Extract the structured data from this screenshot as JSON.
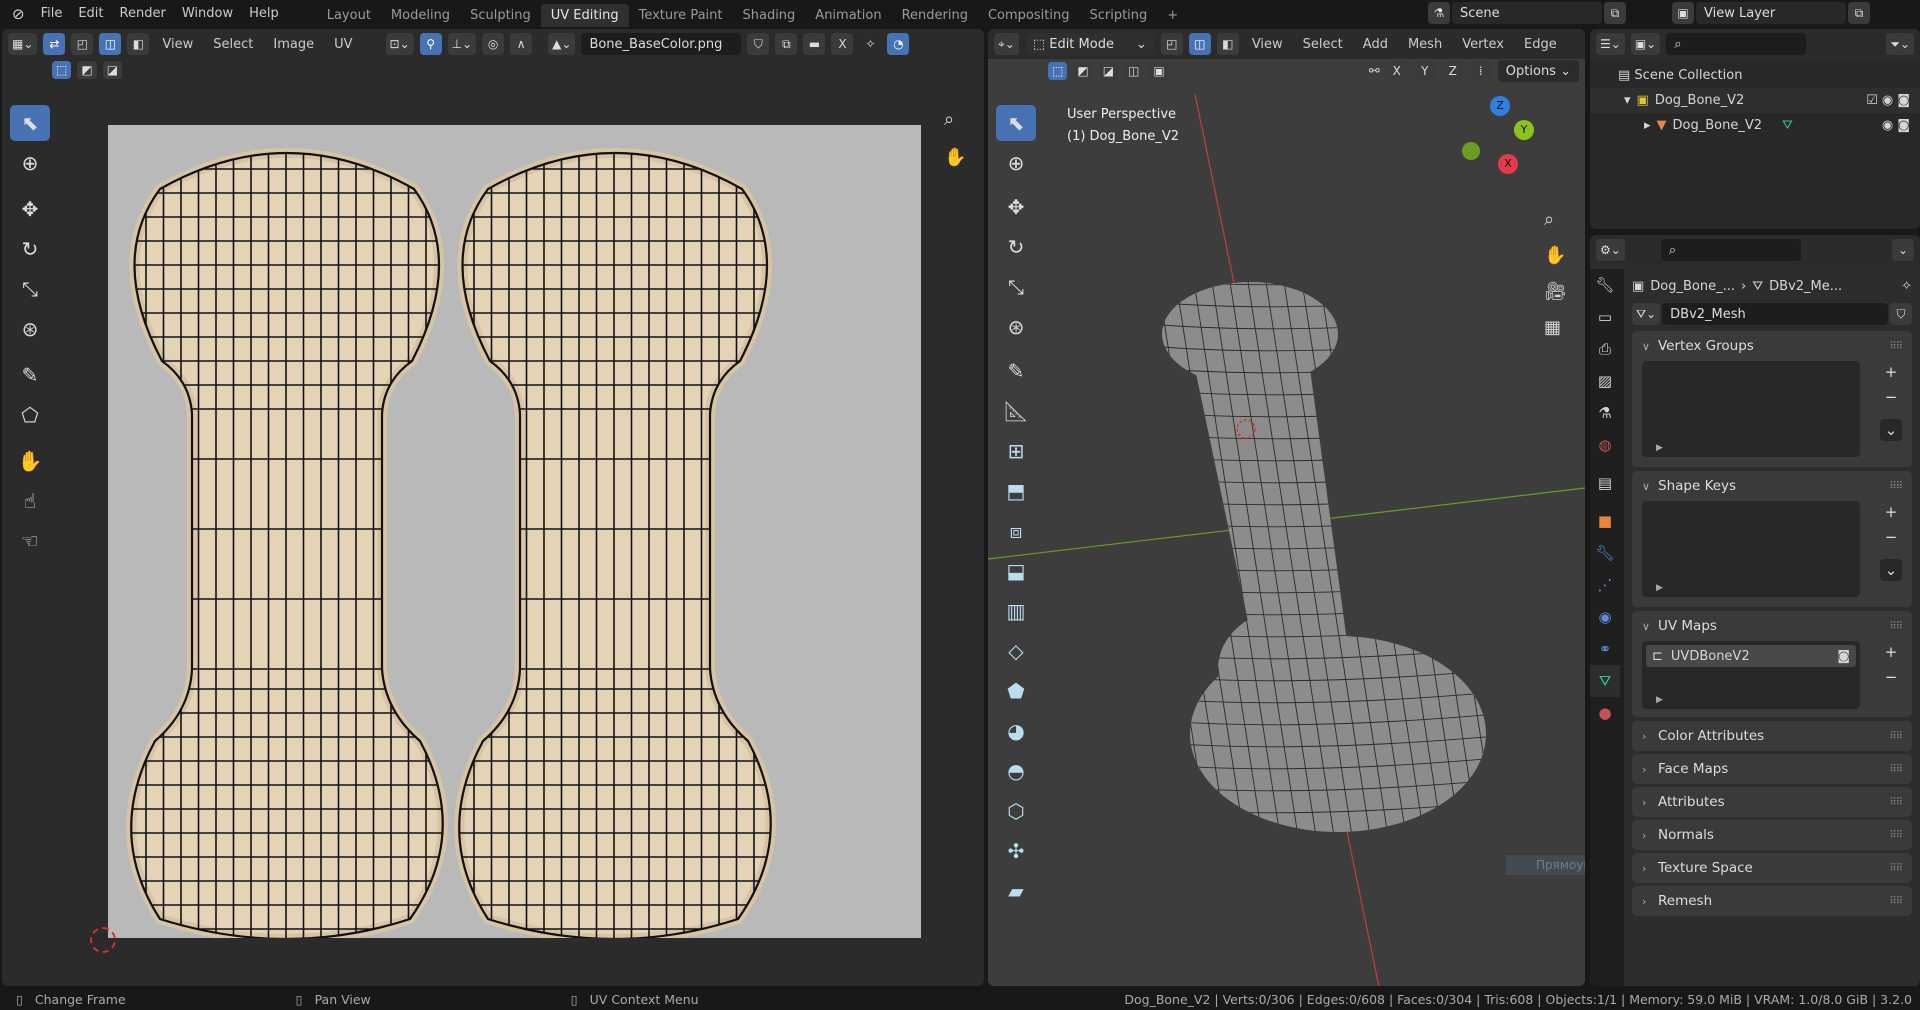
{
  "topbar": {
    "menus": [
      "File",
      "Edit",
      "Render",
      "Window",
      "Help"
    ],
    "workspaces": [
      "Layout",
      "Modeling",
      "Sculpting",
      "UV Editing",
      "Texture Paint",
      "Shading",
      "Animation",
      "Rendering",
      "Compositing",
      "Scripting"
    ],
    "active_workspace": "UV Editing",
    "add_tab": "+",
    "scene": "Scene",
    "view_layer": "View Layer"
  },
  "uv_editor": {
    "menus": [
      "View",
      "Select",
      "Image",
      "UV"
    ],
    "image_name": "Bone_BaseColor.png",
    "close": "X"
  },
  "viewport": {
    "mode": "Edit Mode",
    "menus": [
      "View",
      "Select",
      "Add",
      "Mesh",
      "Vertex",
      "Edge"
    ],
    "axes": [
      "X",
      "Y",
      "Z"
    ],
    "options": "Options",
    "overlay_title": "User Perspective",
    "overlay_object": "(1) Dog_Bone_V2",
    "gizmo": {
      "z": "Z",
      "y": "Y",
      "x": "X"
    },
    "tooltip": "Прямоугольник"
  },
  "outliner": {
    "root": "Scene Collection",
    "collection": "Dog_Bone_V2",
    "object": "Dog_Bone_V2"
  },
  "properties": {
    "breadcrumb_object": "Dog_Bone_...",
    "breadcrumb_mesh": "DBv2_Me...",
    "mesh_name": "DBv2_Mesh",
    "panels_open": [
      "Vertex Groups",
      "Shape Keys",
      "UV Maps"
    ],
    "uv_map": "UVDBoneV2",
    "panels_closed": [
      "Color Attributes",
      "Face Maps",
      "Attributes",
      "Normals",
      "Texture Space",
      "Remesh"
    ]
  },
  "status": {
    "hints": [
      "Change Frame",
      "Pan View",
      "UV Context Menu"
    ],
    "stats": "Dog_Bone_V2 | Verts:0/306 | Edges:0/608 | Faces:0/304 | Tris:608 | Objects:1/1 | Memory: 59.0 MiB | VRAM: 1.0/8.0 GiB | 3.2.0"
  },
  "colors": {
    "accent": "#4772b3",
    "uv_fill": "#e4d3b6",
    "mesh": "#8c8c8c",
    "x_axis": "#c43c45",
    "y_axis": "#6c9a2a"
  }
}
